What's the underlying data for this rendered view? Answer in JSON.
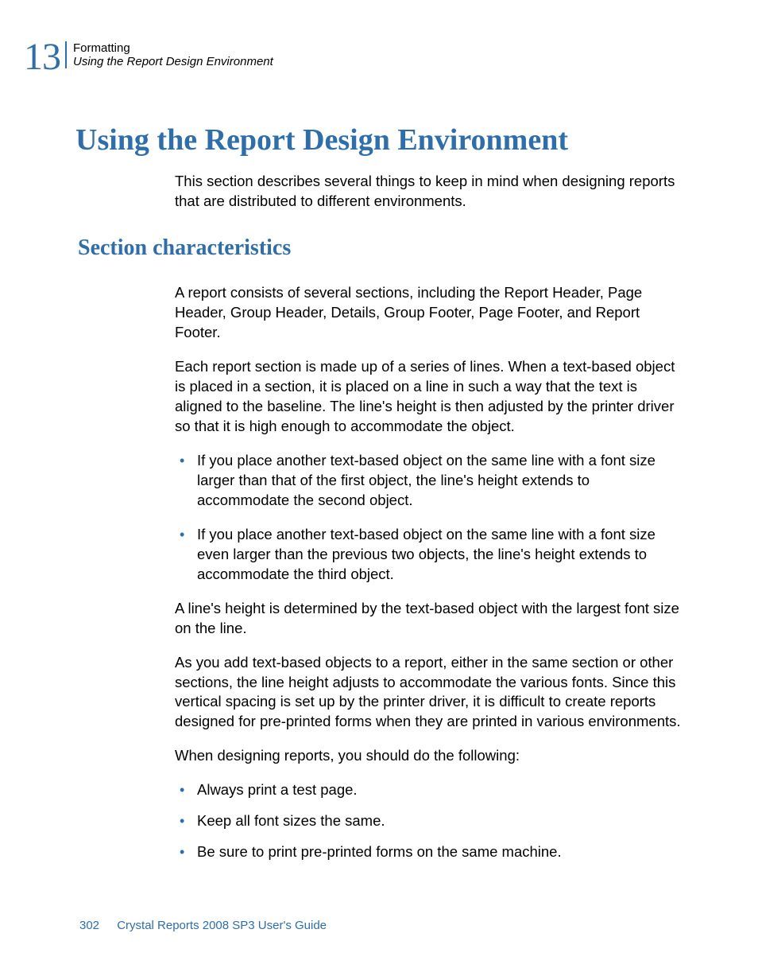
{
  "header": {
    "chapter_number": "13",
    "line1": "Formatting",
    "line2": "Using the Report Design Environment"
  },
  "h1": "Using the Report Design Environment",
  "intro": "This section describes several things to keep in mind when designing reports that are distributed to different environments.",
  "h2": "Section characteristics",
  "p1": "A report consists of several sections, including the Report Header, Page Header, Group Header, Details, Group Footer, Page Footer, and Report Footer.",
  "p2": "Each report section is made up of a series of lines. When a text-based object is placed in a section, it is placed on a line in such a way that the text is aligned to the baseline. The line's height is then adjusted by the printer driver so that it is high enough to accommodate the object.",
  "list1": {
    "item1": "If you place another text-based object on the same line with a font size larger than that of the first object, the line's height extends to accommodate the second object.",
    "item2": "If you place another text-based object on the same line with a font size even larger than the previous two objects, the line's height extends to accommodate the third object."
  },
  "p3": "A line's height is determined by the text-based object with the largest font size on the line.",
  "p4": "As you add text-based objects to a report, either in the same section or other sections, the line height adjusts to accommodate the various fonts. Since this vertical spacing is set up by the printer driver, it is difficult to create reports designed for pre-printed forms when they are printed in various environments.",
  "p5": "When designing reports, you should do the following:",
  "list2": {
    "item1": "Always print a test page.",
    "item2": "Keep all font sizes the same.",
    "item3": "Be sure to print pre-printed forms on the same machine."
  },
  "footer": {
    "page_number": "302",
    "doc_title": "Crystal Reports 2008 SP3 User's Guide"
  }
}
